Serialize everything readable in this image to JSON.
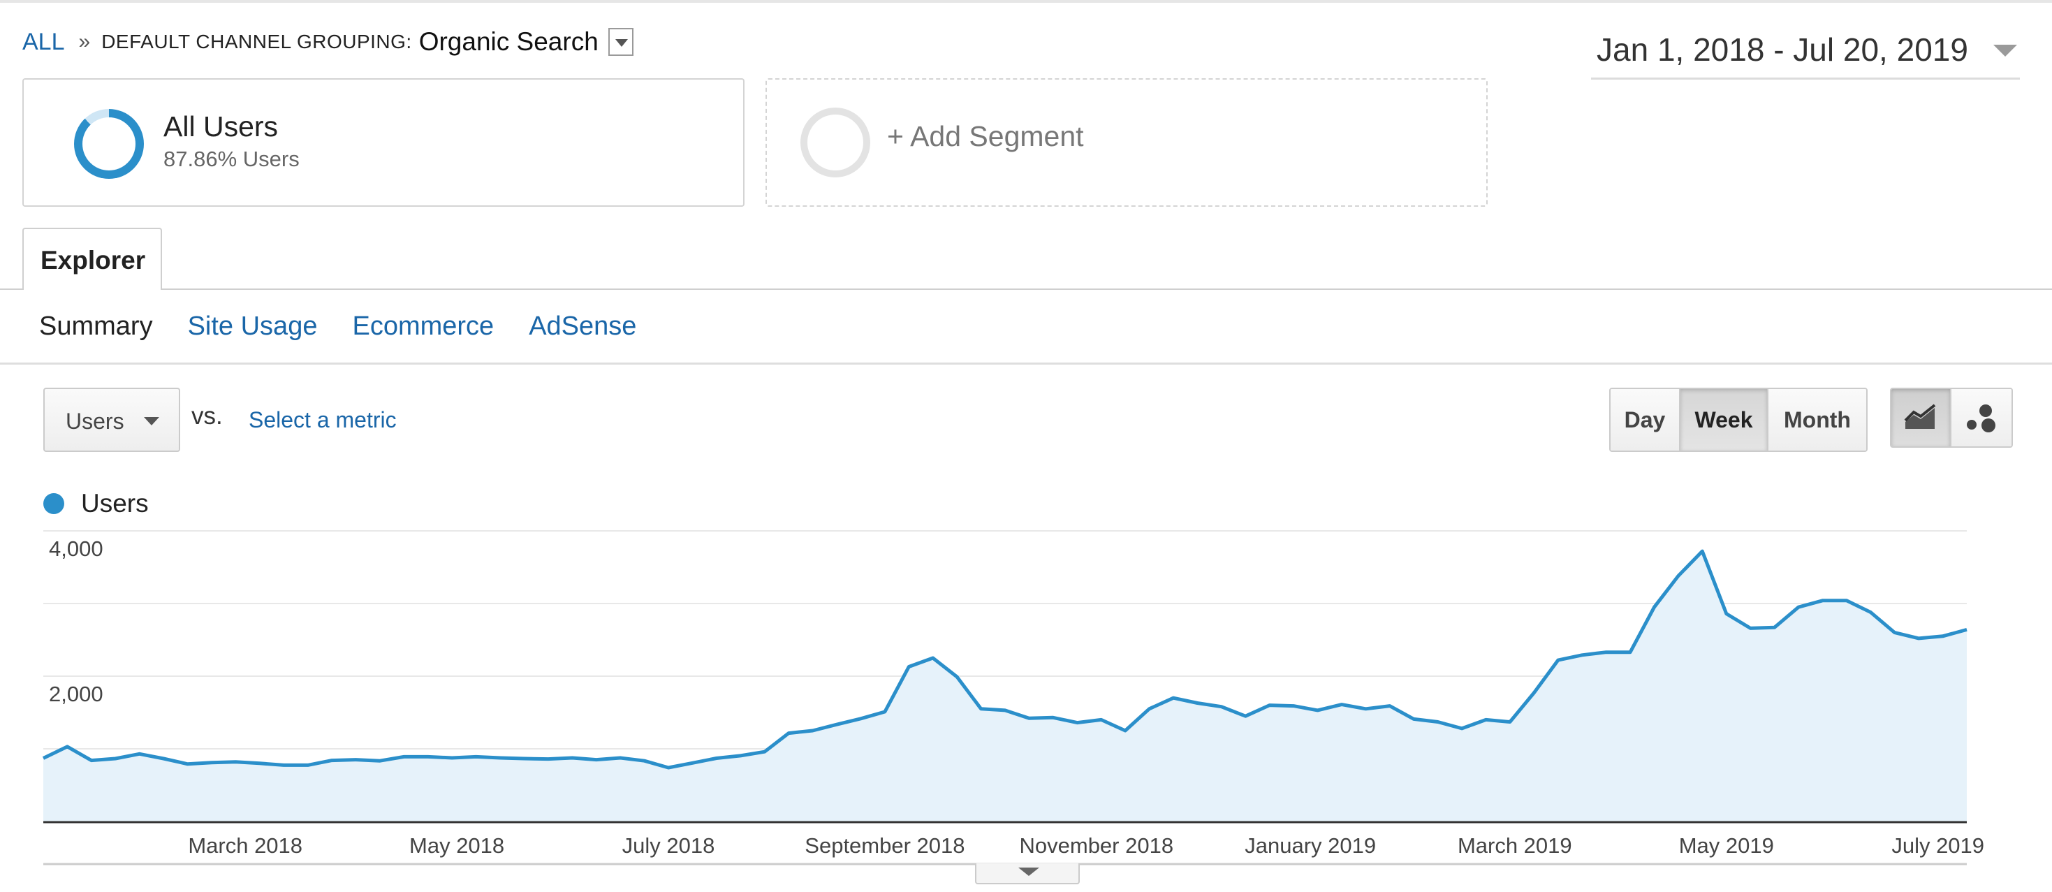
{
  "breadcrumb": {
    "all_label": "ALL",
    "separator": "»",
    "dimension_label": "DEFAULT CHANNEL GROUPING:",
    "dimension_value": "Organic Search"
  },
  "date_range": {
    "label": "Jan 1, 2018 - Jul 20, 2019"
  },
  "segments": {
    "all_users": {
      "title": "All Users",
      "subtitle": "87.86% Users",
      "percent": 87.86
    },
    "add_segment": {
      "label": "+ Add Segment"
    }
  },
  "tabs": {
    "explorer": "Explorer"
  },
  "subtabs": {
    "summary": "Summary",
    "site_usage": "Site Usage",
    "ecommerce": "Ecommerce",
    "adsense": "AdSense"
  },
  "metric_controls": {
    "primary_metric": "Users",
    "vs_label": "vs.",
    "select_metric": "Select a metric"
  },
  "period_buttons": {
    "day": "Day",
    "week": "Week",
    "month": "Month",
    "selected": "Week"
  },
  "view_buttons": {
    "line_icon": "line-chart-icon",
    "motion_icon": "motion-chart-icon",
    "selected": "line"
  },
  "colors": {
    "series": "#2b8fca",
    "area": "#e6f2fa",
    "link": "#1a66a8"
  },
  "chart_data": {
    "type": "area",
    "series": [
      {
        "name": "Users",
        "values": [
          870,
          1030,
          840,
          865,
          930,
          865,
          790,
          810,
          820,
          800,
          775,
          775,
          840,
          850,
          835,
          890,
          890,
          875,
          890,
          875,
          865,
          860,
          875,
          850,
          875,
          835,
          740,
          805,
          870,
          905,
          960,
          1215,
          1250,
          1335,
          1415,
          1510,
          2130,
          2250,
          1990,
          1550,
          1530,
          1420,
          1430,
          1360,
          1400,
          1250,
          1550,
          1700,
          1630,
          1580,
          1450,
          1600,
          1590,
          1530,
          1610,
          1550,
          1590,
          1410,
          1370,
          1280,
          1400,
          1370,
          1770,
          2220,
          2290,
          2330,
          2330,
          2950,
          3380,
          3720,
          2860,
          2660,
          2670,
          2950,
          3040,
          3040,
          2880,
          2600,
          2520,
          2550,
          2640
        ]
      }
    ],
    "ylim": [
      0,
      4000
    ],
    "y_ticks": [
      {
        "value": 2000,
        "label": "2,000"
      },
      {
        "value": 4000,
        "label": "4,000"
      }
    ],
    "x_ticks": [
      {
        "index": 8.4,
        "label": "March 2018"
      },
      {
        "index": 17.2,
        "label": "May 2018"
      },
      {
        "index": 26.0,
        "label": "July 2018"
      },
      {
        "index": 35.0,
        "label": "September 2018"
      },
      {
        "index": 43.8,
        "label": "November 2018"
      },
      {
        "index": 52.7,
        "label": "January 2019"
      },
      {
        "index": 61.2,
        "label": "March 2019"
      },
      {
        "index": 70.0,
        "label": "May 2019"
      },
      {
        "index": 78.8,
        "label": "July 2019"
      }
    ],
    "grid": true,
    "legend": "top-left"
  }
}
